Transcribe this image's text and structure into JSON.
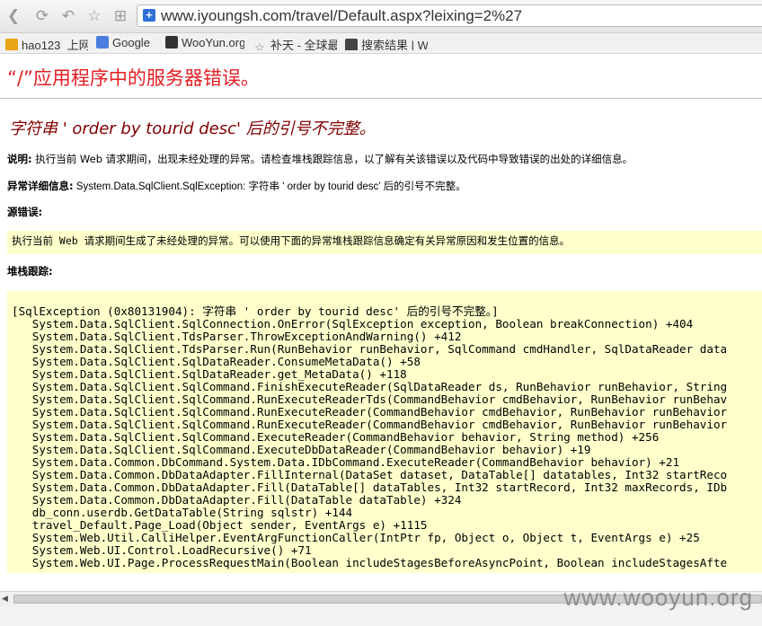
{
  "browser": {
    "url": "www.iyoungsh.com/travel/Default.aspx?leixing=2%27",
    "bookmarks": [
      {
        "label": "hao123_上网",
        "icon": "hao123-icon",
        "color": "#e8a317"
      },
      {
        "label": "Google",
        "icon": "google-icon",
        "color": "#4a7fe0"
      },
      {
        "label": "WooYun.org",
        "icon": "wooyun-icon",
        "color": "#333333"
      },
      {
        "label": "补天 - 全球最",
        "icon": "star-icon",
        "color": "#888888"
      },
      {
        "label": "搜索结果 | W",
        "icon": "search-result-icon",
        "color": "#444444"
      }
    ]
  },
  "page": {
    "heading": "“/”应用程序中的服务器错误。",
    "error_title": "字符串 ' order by tourid desc' 后的引号不完整。",
    "description_label": "说明:",
    "description_text": " 执行当前 Web 请求期间，出现未经处理的异常。请检查堆栈跟踪信息，以了解有关该错误以及代码中导致错误的出处的详细信息。",
    "exception_label": "异常详细信息:",
    "exception_text": " System.Data.SqlClient.SqlException: 字符串 ' order by tourid desc' 后的引号不完整。",
    "source_label": "源错误:",
    "source_text": "执行当前 Web 请求期间生成了未经处理的异常。可以使用下面的异常堆栈跟踪信息确定有关异常原因和发生位置的信息。",
    "stack_label": "堆栈跟踪:",
    "stack_lines": [
      "[SqlException (0x80131904): 字符串 ' order by tourid desc' 后的引号不完整。]",
      "   System.Data.SqlClient.SqlConnection.OnError(SqlException exception, Boolean breakConnection) +404",
      "   System.Data.SqlClient.TdsParser.ThrowExceptionAndWarning() +412",
      "   System.Data.SqlClient.TdsParser.Run(RunBehavior runBehavior, SqlCommand cmdHandler, SqlDataReader data",
      "   System.Data.SqlClient.SqlDataReader.ConsumeMetaData() +58",
      "   System.Data.SqlClient.SqlDataReader.get_MetaData() +118",
      "   System.Data.SqlClient.SqlCommand.FinishExecuteReader(SqlDataReader ds, RunBehavior runBehavior, String",
      "   System.Data.SqlClient.SqlCommand.RunExecuteReaderTds(CommandBehavior cmdBehavior, RunBehavior runBehav",
      "   System.Data.SqlClient.SqlCommand.RunExecuteReader(CommandBehavior cmdBehavior, RunBehavior runBehavior",
      "   System.Data.SqlClient.SqlCommand.RunExecuteReader(CommandBehavior cmdBehavior, RunBehavior runBehavior",
      "   System.Data.SqlClient.SqlCommand.ExecuteReader(CommandBehavior behavior, String method) +256",
      "   System.Data.SqlClient.SqlCommand.ExecuteDbDataReader(CommandBehavior behavior) +19",
      "   System.Data.Common.DbCommand.System.Data.IDbCommand.ExecuteReader(CommandBehavior behavior) +21",
      "   System.Data.Common.DbDataAdapter.FillInternal(DataSet dataset, DataTable[] datatables, Int32 startReco",
      "   System.Data.Common.DbDataAdapter.Fill(DataTable[] dataTables, Int32 startRecord, Int32 maxRecords, IDb",
      "   System.Data.Common.DbDataAdapter.Fill(DataTable dataTable) +324",
      "   db_conn.userdb.GetDataTable(String sqlstr) +144",
      "   travel_Default.Page_Load(Object sender, EventArgs e) +1115",
      "   System.Web.Util.CalliHelper.EventArgFunctionCaller(IntPtr fp, Object o, Object t, EventArgs e) +25",
      "   System.Web.UI.Control.LoadRecursive() +71",
      "   System.Web.UI.Page.ProcessRequestMain(Boolean includeStagesBeforeAsyncPoint, Boolean includeStagesAfte"
    ]
  },
  "watermark": "www.wooyun.org",
  "colors": {
    "heading": "#e31e24",
    "error_title": "#7f0000",
    "code_background": "#ffffcc"
  }
}
